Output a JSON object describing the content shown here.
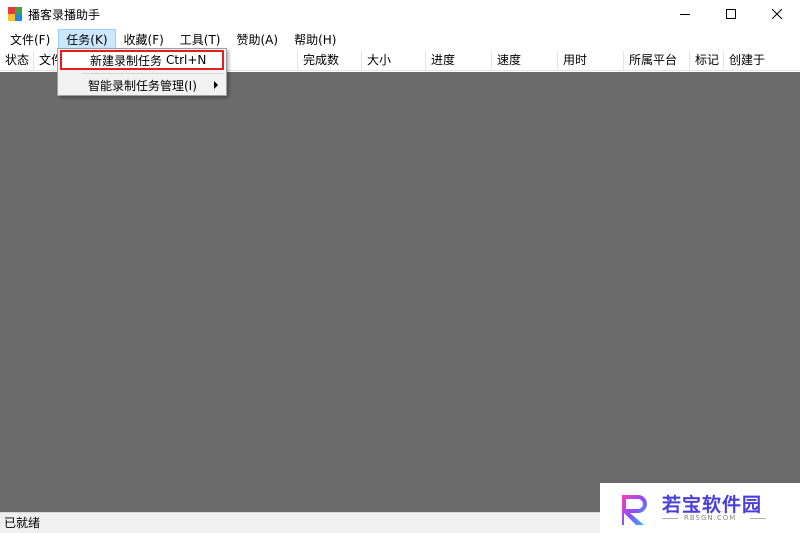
{
  "window": {
    "title": "播客录播助手",
    "controls": [
      "minimize-icon",
      "maximize-icon",
      "close-icon"
    ]
  },
  "menu": [
    {
      "label": "文件(F)"
    },
    {
      "label": "任务(K)",
      "open": true
    },
    {
      "label": "收藏(F)"
    },
    {
      "label": "工具(T)"
    },
    {
      "label": "赞助(A)"
    },
    {
      "label": "帮助(H)"
    }
  ],
  "task_menu": {
    "items": [
      {
        "label": "新建录制任务",
        "shortcut": "Ctrl+N",
        "highlighted": true
      },
      {
        "label": "智能录制任务管理(I)",
        "submenu": true
      }
    ]
  },
  "table": {
    "columns": [
      "状态",
      "文件",
      "完成数",
      "大小",
      "进度",
      "速度",
      "用时",
      "所属平台",
      "标记",
      "创建于"
    ]
  },
  "status": {
    "text": "已就绪"
  },
  "watermark": {
    "brand": "若宝软件园",
    "site": "RBSGN.COM",
    "accent_color": "#4a3fd8"
  }
}
